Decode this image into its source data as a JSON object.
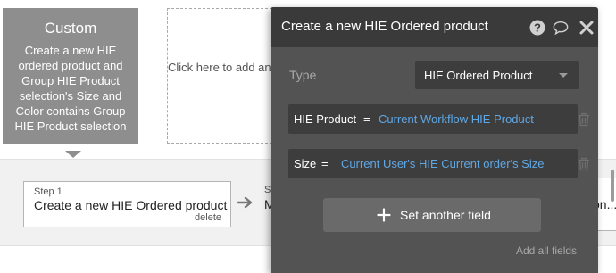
{
  "event": {
    "title": "Custom",
    "description": "Create a new HIE ordered product and Group HIE Product selection's Size and Color contains Group HIE Product selection"
  },
  "add_event": {
    "label": "Click here to add an event..."
  },
  "steps": [
    {
      "label": "Step 1",
      "name": "Create a new HIE Ordered product",
      "delete_label": "delete"
    },
    {
      "label": "S",
      "name": "M"
    }
  ],
  "step3_fragment": "on...",
  "palette": {
    "title": "Create a new HIE Ordered product",
    "type_label": "Type",
    "type_value": "HIE Ordered Product",
    "fields": [
      {
        "key": "HIE Product",
        "eq": "=",
        "value": "Current Workflow HIE Product"
      },
      {
        "key": "Size",
        "eq": "=",
        "value": "Current User's HIE Current order's Size"
      }
    ],
    "set_field_label": "Set another field",
    "add_all_label": "Add all fields"
  },
  "icons": {
    "help": "help-icon",
    "comment": "comment-icon",
    "close": "close-icon",
    "trash": "trash-icon",
    "plus": "plus-icon",
    "arrow": "arrow-right-icon",
    "caret": "chevron-down-icon"
  },
  "colors": {
    "palette_bg": "#535353",
    "palette_header": "#3a3a3a",
    "link_blue": "#5fa8e6",
    "event_gray": "#8e8e8e"
  }
}
